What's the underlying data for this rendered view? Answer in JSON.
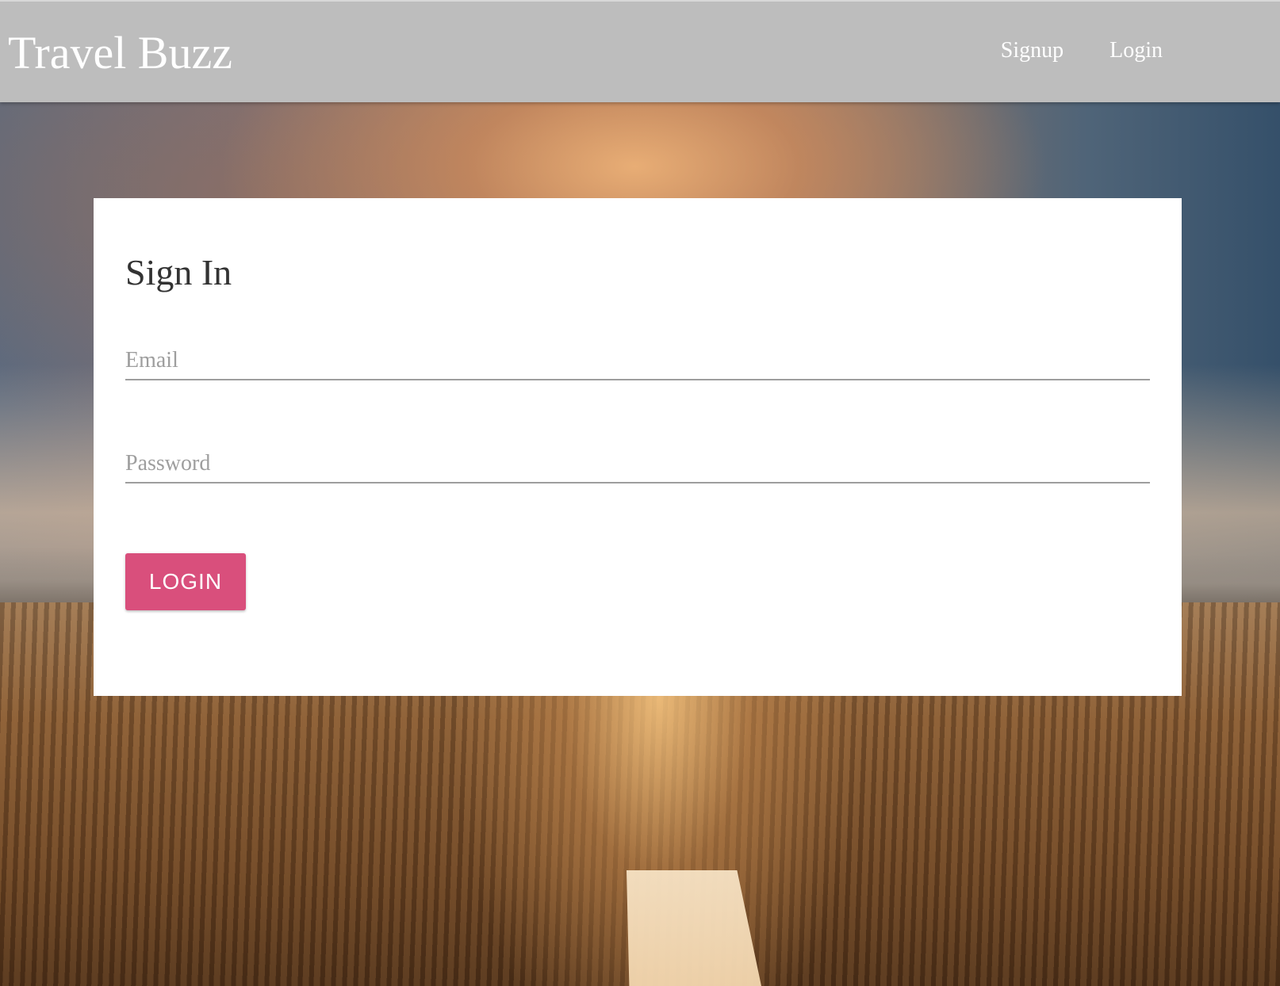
{
  "navbar": {
    "brand": "Travel Buzz",
    "links": [
      {
        "label": "Signup"
      },
      {
        "label": "Login"
      }
    ]
  },
  "signin_card": {
    "title": "Sign In",
    "email_placeholder": "Email",
    "email_value": "",
    "password_placeholder": "Password",
    "password_value": "",
    "submit_label": "LOGIN"
  },
  "colors": {
    "navbar_bg": "#bdbdbd",
    "button_accent": "#d94f7c",
    "card_bg": "#ffffff"
  }
}
